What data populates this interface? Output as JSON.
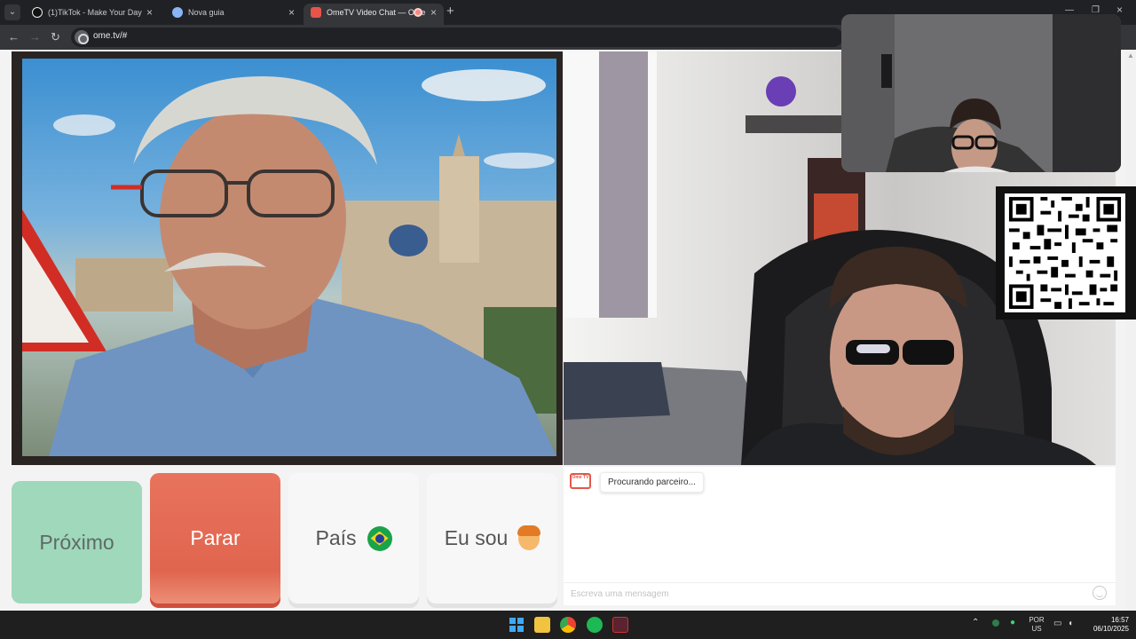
{
  "browser": {
    "tabs": [
      {
        "title": "(1)TikTok - Make Your Day",
        "active": false
      },
      {
        "title": "Nova guia",
        "active": false
      },
      {
        "title": "OmeTV Video Chat — Ome",
        "active": true
      }
    ],
    "url": "ome.tv/#"
  },
  "buttons": {
    "next": "Próximo",
    "stop": "Parar",
    "country": "País",
    "iam": "Eu sou"
  },
  "chat": {
    "logo_text": "Ome TV",
    "status_message": "Procurando parceiro...",
    "input_placeholder": "Escreva uma mensagem"
  },
  "taskbar": {
    "lang_top": "POR",
    "lang_bottom": "US",
    "time": "16:57",
    "date": "06/10/2025"
  },
  "colors": {
    "next_button": "#9fd8bb",
    "stop_button": "#e8735d",
    "neutral_button": "#f7f7f7"
  }
}
